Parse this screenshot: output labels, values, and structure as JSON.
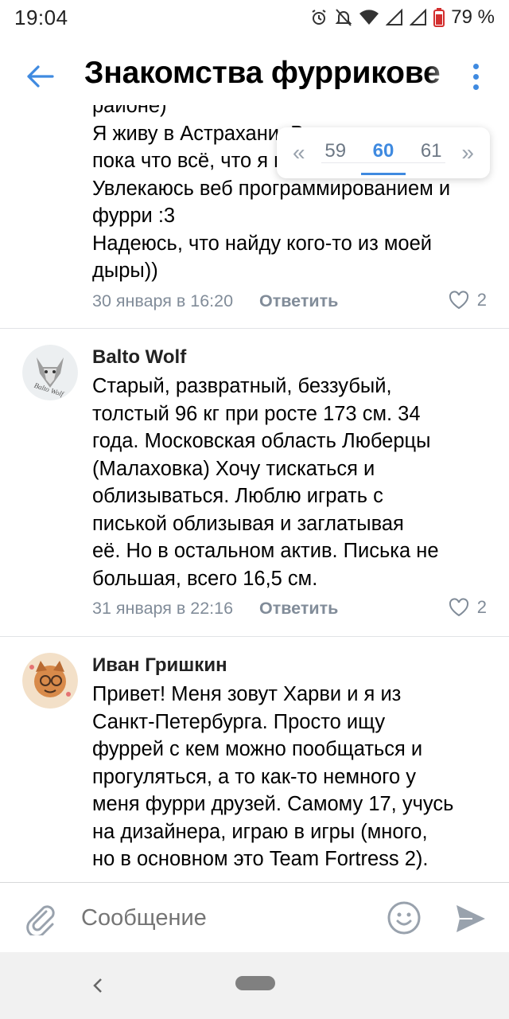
{
  "status_bar": {
    "time": "19:04",
    "battery": "79 %"
  },
  "header": {
    "title": "Знакомства фуррикове",
    "back_icon": "arrow-left-icon",
    "menu_icon": "more-vertical-icon",
    "accent": "#3f8ae0"
  },
  "pagination": {
    "prev": "«",
    "pages": [
      "59",
      "60",
      "61"
    ],
    "current": "60",
    "next": "»"
  },
  "comments": [
    {
      "name": "",
      "lines": [
        "районе)",
        "Я живу в Астрахани. Вот и",
        "пока что всё, что я могу сказать",
        "Увлекаюсь веб программированием и",
        "фурри :3",
        "Надеюсь, что найду кого-то из моей",
        "дыры))"
      ],
      "date": "30 января в 16:20",
      "reply": "Ответить",
      "likes": "2"
    },
    {
      "name": "Balto Wolf",
      "lines": [
        "Старый, развратный, беззубый,",
        "толстый 96 кг при росте 173 см. 34",
        "года. Московская область Люберцы",
        "(Малаховка) Хочу тискаться и",
        "облизываться. Люблю играть с",
        "писькой облизывая и заглатывая",
        "её. Но в остальном актив. Писька не",
        "большая, всего 16,5 см."
      ],
      "date": "31 января в 22:16",
      "reply": "Ответить",
      "likes": "2"
    },
    {
      "name": "Иван Гришкин",
      "lines": [
        "Привет! Меня зовут Харви и я из",
        "Санкт-Петербурга. Просто ищу",
        "фуррей с кем можно пообщаться и",
        "прогуляться, а то как-то немного у",
        "меня фурри друзей. Самому 17, учусь",
        "на дизайнера, играю в игры (много,",
        "но в основном это Team Fortress 2)."
      ]
    }
  ],
  "composer": {
    "placeholder": "Сообщение",
    "attach_icon": "paperclip-icon",
    "emoji_icon": "smile-icon",
    "send_icon": "send-icon"
  }
}
